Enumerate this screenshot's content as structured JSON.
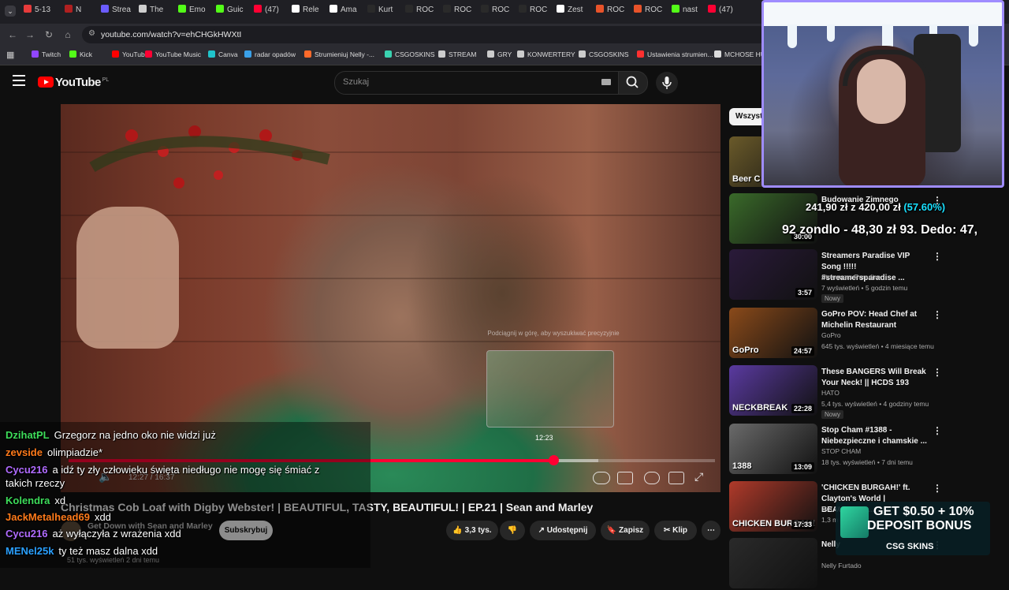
{
  "tabs": [
    {
      "label": "5-13",
      "color": "#e63b3b"
    },
    {
      "label": "N",
      "color": "#b02020"
    },
    {
      "label": "Strea",
      "color": "#6b5cff"
    },
    {
      "label": "The",
      "color": "#cfcfcf"
    },
    {
      "label": "Emo",
      "color": "#53fc18"
    },
    {
      "label": "Guic",
      "color": "#53fc18"
    },
    {
      "label": "(47)",
      "color": "#ff0033"
    },
    {
      "label": "Rele",
      "color": "#ffffff"
    },
    {
      "label": "Ama",
      "color": "#ffffff"
    },
    {
      "label": "Kurt",
      "color": "#2a2a2a"
    },
    {
      "label": "ROC",
      "color": "#2a2a2a"
    },
    {
      "label": "ROC",
      "color": "#2a2a2a"
    },
    {
      "label": "ROC",
      "color": "#2a2a2a"
    },
    {
      "label": "ROC",
      "color": "#2a2a2a"
    },
    {
      "label": "Zest",
      "color": "#ffffff"
    },
    {
      "label": "ROC",
      "color": "#e8532a"
    },
    {
      "label": "ROC",
      "color": "#e8532a"
    },
    {
      "label": "nast",
      "color": "#53fc18"
    },
    {
      "label": "(47)",
      "color": "#ff0033"
    }
  ],
  "address": {
    "url": "youtube.com/watch?v=ehCHGkHWXtI"
  },
  "bookmarks": [
    {
      "label": "Twitch",
      "color": "#9146ff"
    },
    {
      "label": "Kick",
      "color": "#53fc18"
    },
    {
      "label": "YouTube",
      "color": "#ff0000"
    },
    {
      "label": "YouTube Music",
      "color": "#ff0033"
    },
    {
      "label": "Canva",
      "color": "#20c4cb"
    },
    {
      "label": "radar opadów",
      "color": "#3aa0e8"
    },
    {
      "label": "Strumieniuj Nelly -...",
      "color": "#ff6a2a"
    },
    {
      "label": "CSGOSKINS",
      "color": "#3ad2b0"
    },
    {
      "label": "STREAM",
      "color": "#cccccc"
    },
    {
      "label": "GRY",
      "color": "#cccccc"
    },
    {
      "label": "KONWERTERY",
      "color": "#cccccc"
    },
    {
      "label": "CSGOSKINS",
      "color": "#cccccc"
    },
    {
      "label": "Ustawienia strumien...",
      "color": "#ff3030"
    },
    {
      "label": "MCHOSE HUB",
      "color": "#dddddd"
    }
  ],
  "youtube": {
    "logo_text": "YouTube",
    "region": "PL",
    "search_placeholder": "Szukaj"
  },
  "video": {
    "hint": "Podciągnij w górę, aby wyszukiwać precyzyjnie",
    "hover_time": "12:23",
    "time_display": "12:27 / 16:37",
    "progress_fraction": 0.75,
    "title": "Christmas Cob Loaf with Digby Webster! | BEAUTIFUL, TASTY, BEAUTIFUL! | EP.21 | Sean and Marley",
    "channel": "Get Down with Sean and Marley",
    "subscribe": "Subskrybuj",
    "likes": "3,3 tys.",
    "share": "Udostępnij",
    "save": "Zapisz",
    "clip": "Klip",
    "meta": "51 tys. wyświetleń  2 dni temu"
  },
  "chat": [
    {
      "user": "DzihatPL",
      "color": "#3ddc5a",
      "text": "Grzegorz na jedno oko nie widzi już"
    },
    {
      "user": "zevside",
      "color": "#ff7a1a",
      "text": "olimpiadzie*"
    },
    {
      "user": "Cycu216",
      "color": "#b06bff",
      "text": "a idź ty zły człowieku święta niedługo nie mogę się śmiać z"
    },
    {
      "user": "",
      "color": "#ffffff",
      "text": "takich rzeczy"
    },
    {
      "user": "Kolendra",
      "color": "#3ddc5a",
      "text": "xd"
    },
    {
      "user": "JackMetalhead69",
      "color": "#ff7a1a",
      "text": "xdd"
    },
    {
      "user": "Cycu216",
      "color": "#b06bff",
      "text": "aż wyłączyła z wrażenia xdd"
    },
    {
      "user": "MENel25k",
      "color": "#2aa0ff",
      "text": "ty też masz dalna xdd"
    }
  ],
  "sidebar": {
    "chip": "Wszystk",
    "items": [
      {
        "title": "",
        "channel": "",
        "views": "",
        "duration": "",
        "thumb": "#6a5a2a",
        "thumb_text": "Beer C",
        "new": ""
      },
      {
        "title": "Budowanie Zimnego",
        "channel": "",
        "views": "",
        "duration": "30:00",
        "thumb": "#3a6a2a",
        "thumb_text": "",
        "new": ""
      },
      {
        "title": "Streamers Paradise VIP Song !!!!! #streamersparadise ...",
        "channel": "Streamers Paradise",
        "views": "7 wyświetleń • 5 godzin temu",
        "duration": "3:57",
        "thumb": "#2a1a3a",
        "thumb_text": "",
        "new": "Nowy"
      },
      {
        "title": "GoPro POV: Head Chef at Michelin Restaurant",
        "channel": "GoPro",
        "views": "645 tys. wyświetleń • 4 miesiące temu",
        "duration": "24:57",
        "thumb": "#8a4a1a",
        "thumb_text": "GoPro",
        "new": ""
      },
      {
        "title": "These BANGERS Will Break Your Neck! || HCDS 193",
        "channel": "HATO",
        "views": "5,4 tys. wyświetleń • 4 godziny temu",
        "duration": "22:28",
        "thumb": "#5a3aa0",
        "thumb_text": "NECKBREAK",
        "new": "Nowy"
      },
      {
        "title": "Stop Cham #1388 - Niebezpieczne i chamskie ...",
        "channel": "STOP CHAM",
        "views": "18 tys. wyświetleń • 7 dni temu",
        "duration": "13:09",
        "thumb": "#6a6a6a",
        "thumb_text": "1388",
        "new": ""
      },
      {
        "title": "'CHICKEN BURGAH!' ft. Clayton's World | BEAUTIFUL ...",
        "channel": "Get D",
        "views": "1,3 m",
        "duration": "17:33",
        "thumb": "#b03a2a",
        "thumb_text": "CHICKEN BURGAH!",
        "new": ""
      },
      {
        "title": "Nelly",
        "channel": "Nelly Furtado",
        "views": "",
        "duration": "",
        "thumb": "#2a2a2a",
        "thumb_text": "",
        "new": ""
      }
    ]
  },
  "donation": {
    "line1_amount": "241,90 zł z 420,00 zł",
    "line1_pct": "(57.60%)",
    "line2": "92 zondlo - 48,30 zł 93. Dedo: 47,"
  },
  "promo": {
    "line1": "GET $0.50 + 10%",
    "line2": "DEPOSIT BONUS",
    "brand": "CSG SKINS"
  },
  "colors": {
    "accent": "#ff0033",
    "webcam_border": "#9f8cff",
    "pct": "#19e0ff"
  }
}
